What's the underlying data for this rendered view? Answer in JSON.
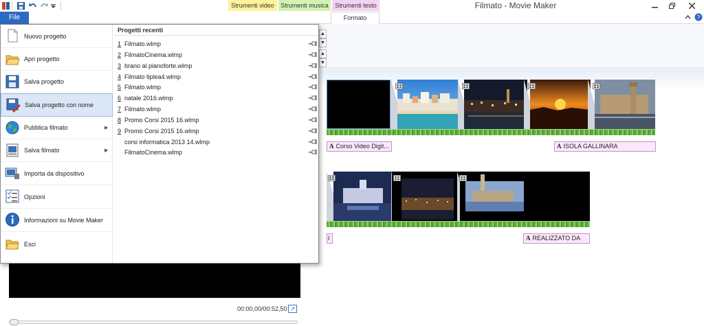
{
  "window": {
    "title": "Filmato - Movie Maker",
    "controls": {
      "help": "?",
      "collapse_ribbon": "^"
    }
  },
  "context_tabs": {
    "video_tools": "Strumenti video",
    "music_tools": "Strumenti musica",
    "text_tools": "Strumenti testo",
    "colors": {
      "video": "#fbf29a",
      "music": "#d2f3b4",
      "text": "#f5d2f3"
    }
  },
  "ribbon": {
    "file_button": "File",
    "active_tab": "Formato"
  },
  "file_menu": {
    "items": [
      {
        "label": "Nuovo progetto",
        "icon": "new-project-icon"
      },
      {
        "label": "Apri progetto",
        "icon": "open-project-icon"
      },
      {
        "label": "Salva progetto",
        "icon": "save-project-icon"
      },
      {
        "label": "Salva progetto con nome",
        "icon": "save-as-icon",
        "selected": true
      },
      {
        "label": "Pubblica filmato",
        "icon": "publish-globe-icon",
        "submenu": true
      },
      {
        "label": "Salva filmato",
        "icon": "save-movie-icon",
        "submenu": true
      },
      {
        "label": "Importa da dispositivo",
        "icon": "import-device-icon"
      },
      {
        "label": "Opzioni",
        "icon": "options-icon"
      },
      {
        "label": "Informazioni su Movie Maker",
        "icon": "info-icon"
      },
      {
        "label": "Esci",
        "icon": "exit-folder-icon"
      }
    ],
    "recent_header": "Progetti recenti",
    "recent": [
      {
        "num": "1",
        "name": "Filmato.wlmp"
      },
      {
        "num": "2",
        "name": "FilmatoCinema.wlmp"
      },
      {
        "num": "3",
        "name": "brano al pianoforte.wlmp"
      },
      {
        "num": "4",
        "name": "Filmato tiplea4.wlmp"
      },
      {
        "num": "5",
        "name": "Filmato.wlmp"
      },
      {
        "num": "6",
        "name": "natale 2016.wlmp"
      },
      {
        "num": "7",
        "name": "Filmato.wlmp"
      },
      {
        "num": "8",
        "name": "Promo Corsi 2015 16.wlmp"
      },
      {
        "num": "9",
        "name": "Promo Corsi 2015 16.wlmp"
      },
      {
        "num": "",
        "name": "corsi informatica 2013 14.wlmp"
      },
      {
        "num": "",
        "name": "FilmatoCinema.wlmp"
      }
    ]
  },
  "storyboard": {
    "row1_captions": {
      "first": "Corso Video Digit...",
      "second": "ISOLA GALLINARA"
    },
    "row2_captions": {
      "first": "I",
      "second": "REALIZZATO DA"
    },
    "caption_icon": "A"
  },
  "preview": {
    "timecode": "00:00,00/00:52,50",
    "fullscreen_icon": "fullscreen-icon"
  }
}
